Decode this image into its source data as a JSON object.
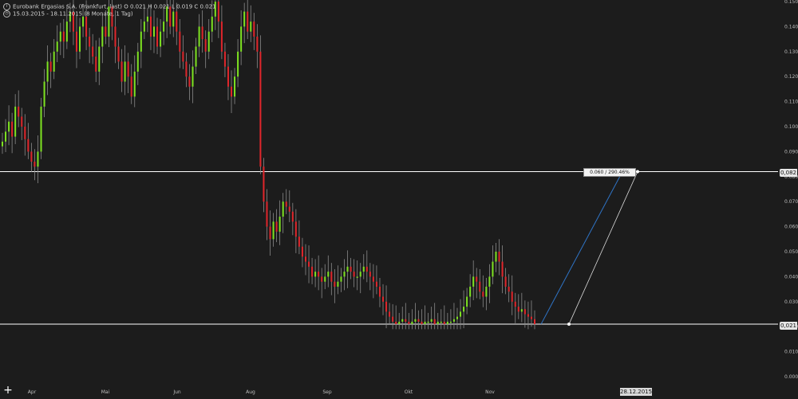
{
  "header": {
    "instrument_line": "Eurobank Ergasias S.A. (Frankfurt, last)  O 0.021  H 0.021  L 0.019  C 0.021",
    "range_line": "15.03.2015 - 18.11.2015 (8 Monate, 1 Tag)"
  },
  "badges": {
    "date": "28.12.2015",
    "upper_level": "0,082",
    "lower_level": "0,021",
    "measure": "0.060 / 290.46%"
  },
  "colors": {
    "background": "#1c1c1c",
    "up_candle": "#7ee321",
    "down_candle": "#e0262b",
    "level_line": "#ffffff",
    "trend_line": "#2f74c6",
    "axis_text": "#bfbfbf"
  },
  "icons": {
    "add": "plus-icon",
    "instrument": "chart-info-icon",
    "range": "clock-icon"
  },
  "chart_data": {
    "type": "candlestick",
    "y_ticks": [
      "0.150",
      "0.140",
      "0.130",
      "0.120",
      "0.110",
      "0.100",
      "0.090",
      "0.080",
      "0.070",
      "0.060",
      "0.050",
      "0.040",
      "0.030",
      "0.020",
      "0.010",
      "0.000"
    ],
    "x_ticks": [
      "Apr",
      "Mai",
      "Jun",
      "Aug",
      "Sep",
      "Okt",
      "Nov"
    ],
    "ylim": [
      0.0,
      0.15
    ],
    "horizontal_levels": [
      0.082,
      0.021
    ],
    "grid": false,
    "close_path": [
      0.094,
      0.098,
      0.102,
      0.096,
      0.108,
      0.104,
      0.1,
      0.095,
      0.09,
      0.086,
      0.084,
      0.09,
      0.108,
      0.118,
      0.126,
      0.122,
      0.13,
      0.134,
      0.138,
      0.134,
      0.142,
      0.146,
      0.138,
      0.13,
      0.14,
      0.144,
      0.136,
      0.132,
      0.128,
      0.122,
      0.132,
      0.14,
      0.136,
      0.148,
      0.14,
      0.132,
      0.126,
      0.118,
      0.126,
      0.12,
      0.112,
      0.122,
      0.13,
      0.138,
      0.142,
      0.144,
      0.136,
      0.14,
      0.132,
      0.138,
      0.142,
      0.148,
      0.14,
      0.146,
      0.138,
      0.13,
      0.126,
      0.12,
      0.116,
      0.124,
      0.132,
      0.14,
      0.135,
      0.13,
      0.138,
      0.144,
      0.15,
      0.142,
      0.13,
      0.124,
      0.116,
      0.112,
      0.12,
      0.13,
      0.14,
      0.146,
      0.138,
      0.142,
      0.136,
      0.13,
      0.084,
      0.07,
      0.06,
      0.055,
      0.062,
      0.058,
      0.064,
      0.07,
      0.068,
      0.066,
      0.062,
      0.056,
      0.052,
      0.048,
      0.046,
      0.044,
      0.04,
      0.042,
      0.04,
      0.038,
      0.04,
      0.042,
      0.038,
      0.036,
      0.038,
      0.04,
      0.042,
      0.044,
      0.042,
      0.04,
      0.04,
      0.042,
      0.044,
      0.042,
      0.04,
      0.038,
      0.036,
      0.032,
      0.03,
      0.026,
      0.024,
      0.022,
      0.021,
      0.022,
      0.023,
      0.022,
      0.021,
      0.022,
      0.023,
      0.022,
      0.021,
      0.022,
      0.022,
      0.023,
      0.021,
      0.022,
      0.022,
      0.021,
      0.022,
      0.022,
      0.023,
      0.024,
      0.026,
      0.028,
      0.032,
      0.036,
      0.04,
      0.038,
      0.034,
      0.032,
      0.036,
      0.04,
      0.046,
      0.05,
      0.046,
      0.04,
      0.036,
      0.034,
      0.03,
      0.028,
      0.026,
      0.027,
      0.025,
      0.024,
      0.023,
      0.021
    ],
    "trend_lines": [
      {
        "name": "measure",
        "from": [
          "18.11.2015",
          0.021
        ],
        "to": [
          "28.12.2015",
          0.082
        ]
      },
      {
        "name": "parallel",
        "from": [
          "28.12.2015",
          0.021
        ],
        "to": [
          "28.12.2015",
          0.082
        ]
      }
    ]
  }
}
